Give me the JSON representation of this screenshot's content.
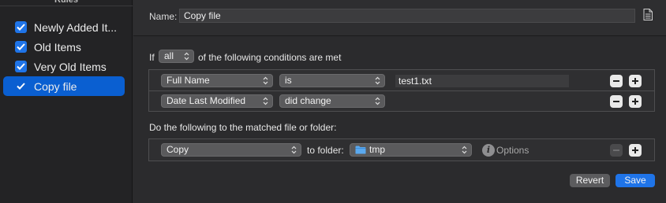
{
  "sidebar": {
    "header": "Rules",
    "items": [
      {
        "label": "Newly Added It...",
        "checked": true,
        "selected": false
      },
      {
        "label": "Old Items",
        "checked": true,
        "selected": false
      },
      {
        "label": "Very Old Items",
        "checked": true,
        "selected": false
      },
      {
        "label": "Copy file",
        "checked": true,
        "selected": true
      }
    ]
  },
  "name_bar": {
    "label": "Name:",
    "value": "Copy file",
    "icon": "document-icon"
  },
  "conditions": {
    "prefix": "If",
    "match_mode": "all",
    "suffix": "of the following conditions are met",
    "rows": [
      {
        "attribute": "Full Name",
        "operator": "is",
        "value": "test1.txt"
      },
      {
        "attribute": "Date Last Modified",
        "operator": "did change",
        "value": ""
      }
    ]
  },
  "actions": {
    "heading": "Do the following to the matched file or folder:",
    "rows": [
      {
        "action": "Copy",
        "target_label": "to folder:",
        "folder": "tmp",
        "options_label": "Options"
      }
    ]
  },
  "footer": {
    "revert_label": "Revert",
    "save_label": "Save"
  },
  "colors": {
    "accent": "#1f74e8",
    "selection": "#0a5fd1",
    "folder": "#5aa9f0"
  }
}
